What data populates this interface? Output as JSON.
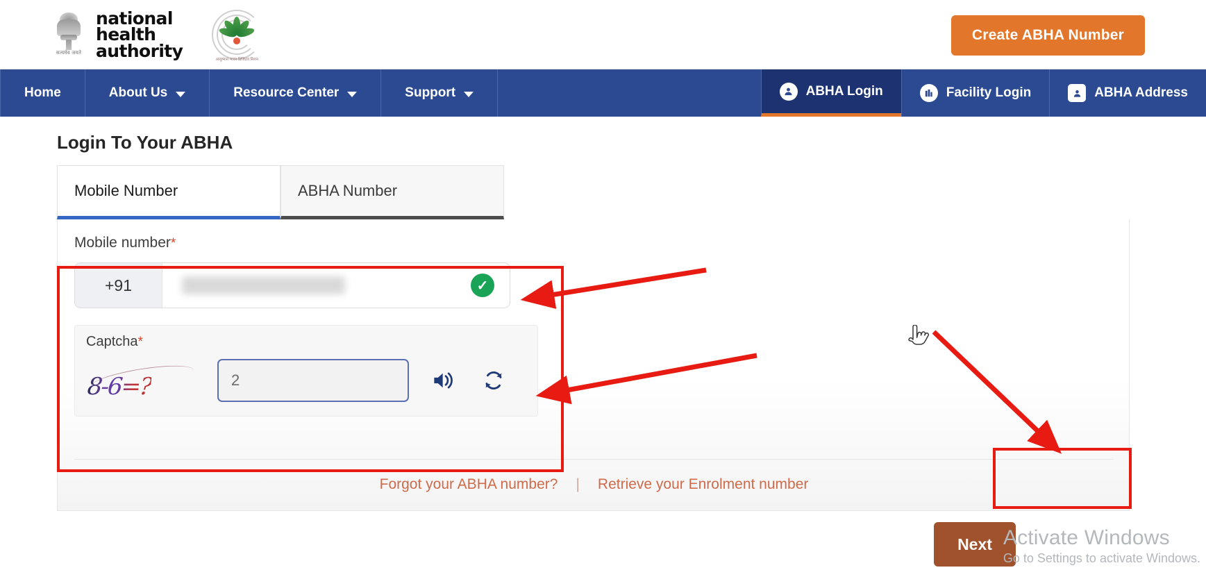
{
  "header": {
    "org_name_lines": [
      "national",
      "health",
      "authority"
    ],
    "emblem_motto": "सत्यमेव जयते",
    "abdm_caption": "आयुष्मान भारत डिजिटल मिशन",
    "create_button": "Create ABHA Number"
  },
  "nav": {
    "left_items": [
      {
        "label": "Home",
        "has_caret": false,
        "icon": ""
      },
      {
        "label": "About Us",
        "has_caret": true,
        "icon": "chevron-down-icon"
      },
      {
        "label": "Resource Center",
        "has_caret": true,
        "icon": "chevron-down-icon"
      },
      {
        "label": "Support",
        "has_caret": true,
        "icon": "chevron-down-icon"
      }
    ],
    "right_tabs": [
      {
        "label": "ABHA Login",
        "icon": "user-lock-icon",
        "glyph": "☺",
        "active": true
      },
      {
        "label": "Facility Login",
        "icon": "building-icon",
        "glyph": "☷",
        "active": false
      },
      {
        "label": "ABHA Address",
        "icon": "id-card-icon",
        "glyph": "☻",
        "active": false
      }
    ],
    "active_tab": "ABHA Login",
    "accent_color": "#e2762a",
    "bar_color": "#2b4a92",
    "active_tab_color": "#1c3271"
  },
  "main": {
    "page_title": "Login To Your ABHA",
    "tabs": [
      {
        "label": "Mobile Number",
        "selected": true
      },
      {
        "label": "ABHA Number",
        "selected": false
      }
    ],
    "mobile_field": {
      "label": "Mobile number",
      "required_mark": "*",
      "country_code": "+91",
      "value": "",
      "value_masked": true,
      "validated": true,
      "check_glyph": "✓"
    },
    "captcha": {
      "label": "Captcha",
      "required_mark": "*",
      "challenge_text": "8-6=?",
      "input_value": "2",
      "speaker_icon": "speaker-icon",
      "refresh_icon": "refresh-icon"
    },
    "next_button": "Next",
    "footer": {
      "forgot_link": "Forgot your ABHA number?",
      "divider": "|",
      "retrieve_link": "Retrieve your Enrolment number"
    }
  },
  "annotations": {
    "highlight_color": "#e81b13",
    "boxes": [
      "mobile-and-captcha-fields",
      "next-button"
    ],
    "arrow_count": 3
  },
  "watermark": {
    "line1": "Activate Windows",
    "line2": "Go to Settings to activate Windows."
  }
}
